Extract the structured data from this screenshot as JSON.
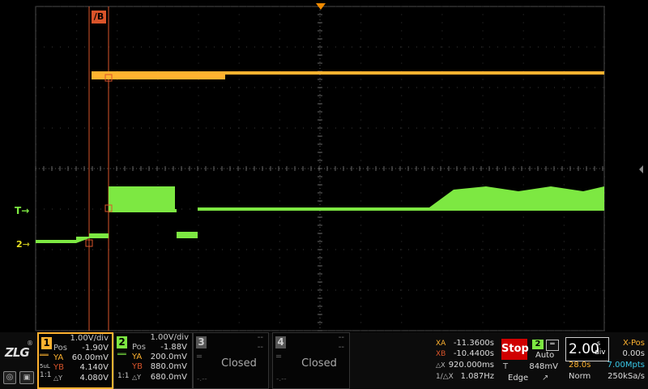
{
  "colors": {
    "ch1": "#ffb330",
    "ch2": "#7de842",
    "cursor": "#d9542a",
    "grid": "#4a4a4a",
    "trigger": "#f08a00"
  },
  "cursor_tag": "/B",
  "trigger_indicator": "T",
  "ch2_indicator": "2",
  "logo": "ZLG",
  "ch1": {
    "num": "1",
    "vdiv": "1.00V/div",
    "pos_label": "Pos",
    "pos": "-1.90V",
    "ya_label": "YA",
    "ya": "60.00mV",
    "yb_label": "YB",
    "yb": "4.140V",
    "dy_label": "△Y",
    "dy": "4.080V",
    "coupling": "DC",
    "mode": "5uL",
    "ratio": "1:1"
  },
  "ch2": {
    "num": "2",
    "vdiv": "1.00V/div",
    "pos_label": "Pos",
    "pos": "-1.88V",
    "ya_label": "YA",
    "ya": "200.0mV",
    "yb_label": "YB",
    "yb": "880.0mV",
    "dy_label": "△Y",
    "dy": "680.0mV",
    "coupling": "DC",
    "ratio": "1:1"
  },
  "ch3": {
    "num": "3",
    "status": "Closed",
    "dash": "--"
  },
  "ch4": {
    "num": "4",
    "status": "Closed",
    "dash": "--"
  },
  "cursors": {
    "xa_label": "XA",
    "xa": "-11.3600s",
    "xb_label": "XB",
    "xb": "-10.4400s",
    "dx_label": "△X",
    "dx": "920.000ms",
    "inv_label": "1/△X",
    "inv": "1.087Hz"
  },
  "run": {
    "state": "Stop",
    "trig_src": "2",
    "trig_mode": "Auto",
    "t_label": "T",
    "t_level": "848mV",
    "trig_type": "Edge"
  },
  "timebase": {
    "value": "2.00",
    "unit_top": "s",
    "unit_bottom": "div",
    "xpos_label": "X-Pos",
    "xpos": "0.00s",
    "window": "28.0s",
    "memory": "7.00Mpts",
    "acq": "Norm",
    "rate": "250kSa/s"
  }
}
